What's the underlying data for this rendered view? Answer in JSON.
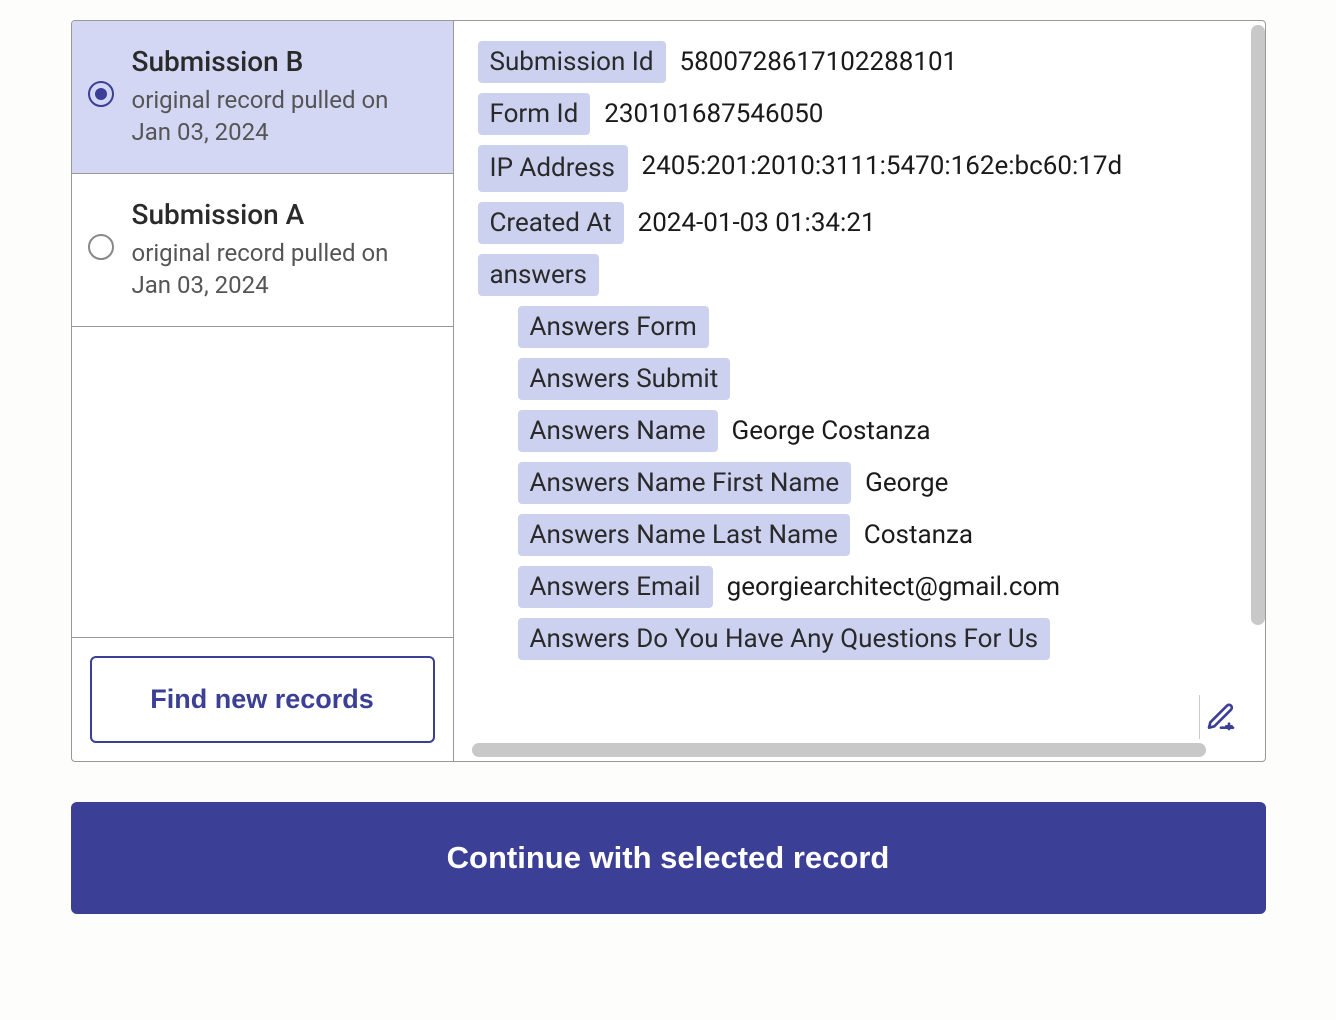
{
  "sidebar": {
    "records": [
      {
        "title": "Submission B",
        "subtitle": "original record pulled on Jan 03, 2024",
        "selected": true
      },
      {
        "title": "Submission A",
        "subtitle": "original record pulled on Jan 03, 2024",
        "selected": false
      }
    ],
    "find_button": "Find new records"
  },
  "detail": {
    "fields": {
      "submission_id": {
        "label": "Submission Id",
        "value": "5800728617102288101"
      },
      "form_id": {
        "label": "Form Id",
        "value": "230101687546050"
      },
      "ip_address": {
        "label": "IP Address",
        "value": "2405:201:2010:3111:5470:162e:bc60:17d"
      },
      "created_at": {
        "label": "Created At",
        "value": "2024-01-03 01:34:21"
      },
      "answers_header": {
        "label": "answers"
      },
      "answers": {
        "form": {
          "label": "Answers Form",
          "value": ""
        },
        "submit": {
          "label": "Answers Submit",
          "value": ""
        },
        "name": {
          "label": "Answers Name",
          "value": "George Costanza"
        },
        "first_name": {
          "label": "Answers Name First Name",
          "value": "George"
        },
        "last_name": {
          "label": "Answers Name Last Name",
          "value": "Costanza"
        },
        "email": {
          "label": "Answers Email",
          "value": "georgiearchitect@gmail.com"
        },
        "questions": {
          "label": "Answers Do You Have Any Questions For Us",
          "value": ""
        }
      }
    }
  },
  "continue_button": "Continue with selected record"
}
